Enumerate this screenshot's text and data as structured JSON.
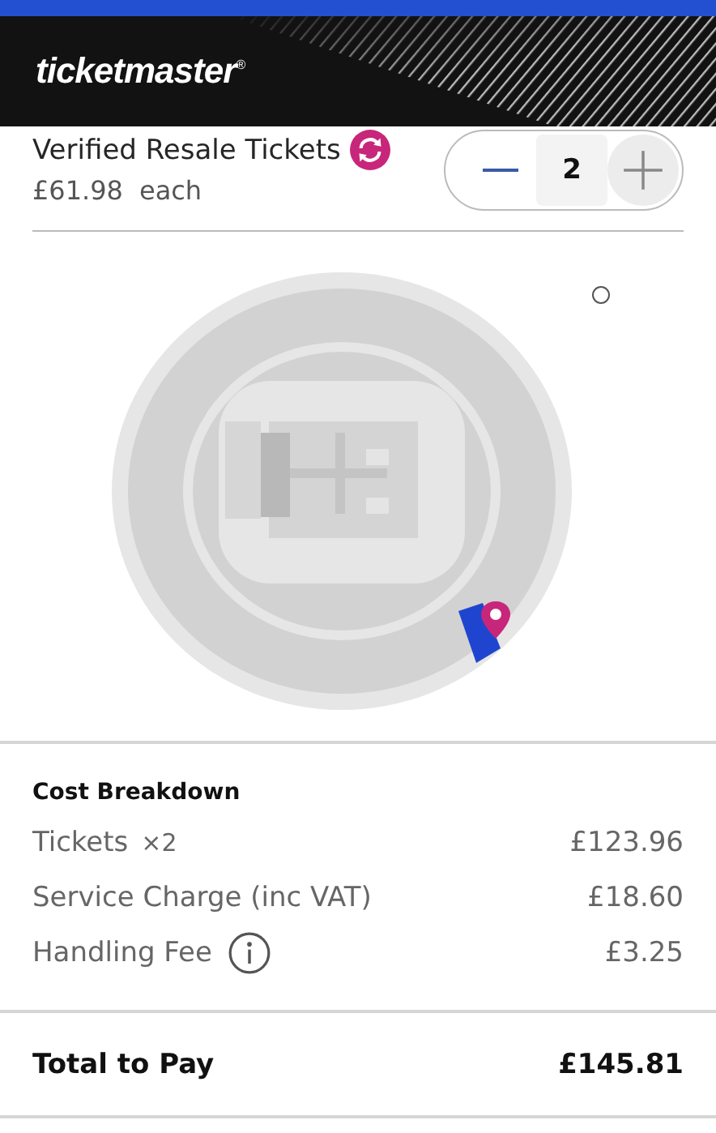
{
  "header": {
    "logo": "ticketmaster$^{®}$"
  },
  "ticket": {
    "title": "Verified Resale Tickets",
    "price": "£61.98",
    "price_unit": "each",
    "quantity": "2"
  },
  "cost_breakdown": {
    "title": "Cost Breakdown",
    "rows": [
      {
        "label": "Tickets",
        "qty": "×2",
        "amount": "£123.96",
        "info": false
      },
      {
        "label": "Service Charge (inc VAT)",
        "amount": "£18.60",
        "info": false
      },
      {
        "label": "Handling Fee",
        "amount": "£3.25",
        "info": true
      }
    ]
  },
  "total": {
    "label": "Total to Pay",
    "amount": "£145.81"
  }
}
